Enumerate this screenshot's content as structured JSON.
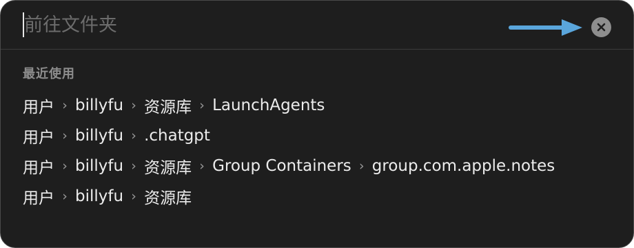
{
  "search": {
    "placeholder": "前往文件夹",
    "value": ""
  },
  "icons": {
    "clear": "close-circle-icon",
    "separator": "chevron-right-icon"
  },
  "colors": {
    "background": "#1e1e1e",
    "arrow": "#5aa6dc",
    "clear_button": "#8e8e8e"
  },
  "recents": {
    "title": "最近使用",
    "separator": "›",
    "items": [
      [
        "用户",
        "billyfu",
        "资源库",
        "LaunchAgents"
      ],
      [
        "用户",
        "billyfu",
        ".chatgpt"
      ],
      [
        "用户",
        "billyfu",
        "资源库",
        "Group Containers",
        "group.com.apple.notes"
      ],
      [
        "用户",
        "billyfu",
        "资源库"
      ]
    ]
  }
}
